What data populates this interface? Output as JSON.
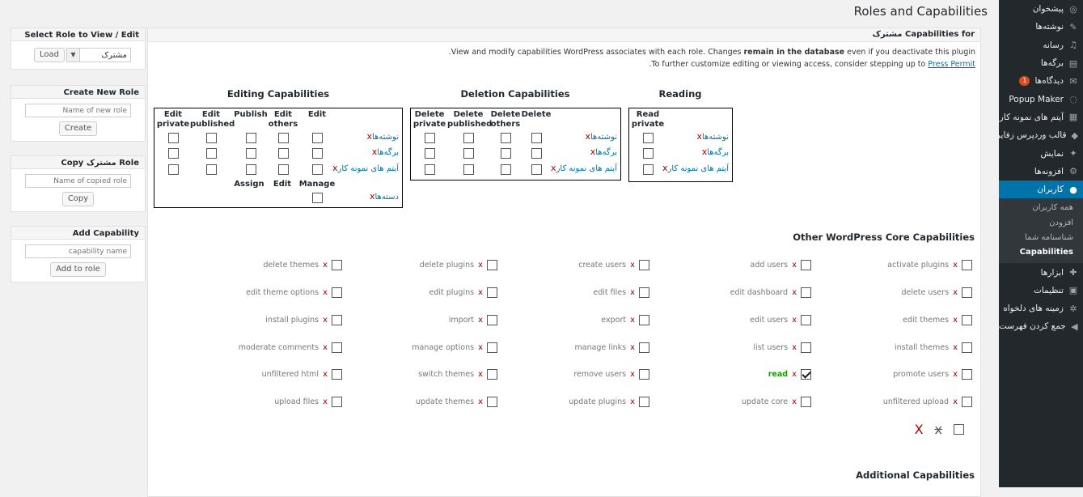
{
  "page": {
    "title": "Roles and Capabilities"
  },
  "admin_menu": {
    "items": [
      {
        "label": "پیشخوان",
        "icon": "dashboard-icon",
        "glyph": "◎"
      },
      {
        "label": "نوشته‌ها",
        "icon": "pin-icon",
        "glyph": "✎"
      },
      {
        "label": "رسانه",
        "icon": "media-icon",
        "glyph": "♫"
      },
      {
        "label": "برگه‌ها",
        "icon": "page-icon",
        "glyph": "▤"
      },
      {
        "label": "دیدگاه‌ها",
        "icon": "comment-icon",
        "glyph": "✉",
        "badge": "1"
      },
      {
        "label": "Popup Maker",
        "icon": "popup-icon",
        "glyph": "◌"
      },
      {
        "label": "آیتم های نمونه کار",
        "icon": "portfolio-icon",
        "glyph": "▦"
      },
      {
        "label": "قالب وردپرس زفایر",
        "icon": "diamond-icon",
        "glyph": "◆"
      },
      {
        "label": "نمایش",
        "icon": "appearance-icon",
        "glyph": "✦"
      },
      {
        "label": "افزونه‌ها",
        "icon": "plugin-icon",
        "glyph": "⚙"
      },
      {
        "label": "کاربران",
        "icon": "user-icon",
        "glyph": "●",
        "active": true
      }
    ],
    "submenu": [
      "همه کاربران",
      "افزودن",
      "شناسنامه شما",
      "Capabilities"
    ],
    "items_after": [
      {
        "label": "ابزارها",
        "icon": "tools-icon",
        "glyph": "✚"
      },
      {
        "label": "تنظیمات",
        "icon": "settings-icon",
        "glyph": "▣"
      },
      {
        "label": "زمینه های دلخواه",
        "icon": "gear-icon",
        "glyph": "✲"
      },
      {
        "label": "جمع کردن فهرست",
        "icon": "collapse-icon",
        "glyph": "◀"
      }
    ]
  },
  "sidebar": {
    "select_role": {
      "title": "Select Role to View / Edit",
      "selected": "مشترک",
      "button": "Load"
    },
    "create_role": {
      "title": "Create New Role",
      "placeholder": "Name of new role",
      "button": "Create"
    },
    "copy_role": {
      "title": "Copy مشترک Role",
      "placeholder": "Name of copied role",
      "button": "Copy"
    },
    "add_capability": {
      "title": "Add Capability",
      "placeholder": "capability name",
      "button": "Add to role"
    }
  },
  "main": {
    "header": "Capabilities for مشترک",
    "intro_line1_a": "View and modify capabilities WordPress associates with each role. Changes ",
    "intro_line1_b": "remain in the database",
    "intro_line1_c": " even if you deactivate this plugin.",
    "intro_line2_a": "To further customize editing or viewing access, consider stepping up to ",
    "intro_line2_link": "Press Permit",
    "intro_line2_b": ".",
    "editing": {
      "title": "Editing Capabilities",
      "columns": [
        "Edit private",
        "Edit published",
        "Publish",
        "Edit others",
        "Edit"
      ],
      "rows": [
        "نوشته‌ها",
        "برگه‌ها",
        "آیتم های نمونه کار"
      ],
      "tax_columns": [
        "Assign",
        "Edit",
        "Manage"
      ],
      "tax_row": "دسته‌ها"
    },
    "deletion": {
      "title": "Deletion Capabilities",
      "columns": [
        "Delete private",
        "Delete published",
        "Delete others",
        "Delete"
      ],
      "rows": [
        "نوشته‌ها",
        "برگه‌ها",
        "آیتم های نمونه کار"
      ]
    },
    "reading": {
      "title": "Reading",
      "columns": [
        "Read private"
      ],
      "rows": [
        "نوشته‌ها",
        "برگه‌ها",
        "آیتم های نمونه کار"
      ]
    },
    "row_x": "x",
    "core": {
      "title": "Other WordPress Core Capabilities",
      "columns": [
        [
          "activate plugins",
          "delete users",
          "edit themes",
          "install themes",
          "promote users",
          "unfiltered upload"
        ],
        [
          "add users",
          "edit dashboard",
          "edit users",
          "list users",
          "read",
          "update core"
        ],
        [
          "create users",
          "edit files",
          "export",
          "manage links",
          "remove users",
          "update plugins"
        ],
        [
          "delete plugins",
          "edit plugins",
          "import",
          "manage options",
          "switch themes",
          "update themes"
        ],
        [
          "delete themes",
          "edit theme options",
          "install plugins",
          "moderate comments",
          "unfiltered html",
          "upload files"
        ]
      ],
      "checked": [
        "read"
      ],
      "x": "x",
      "extra_big_x": "X",
      "extra_strike_x": "x"
    },
    "additional_title": "Additional Capabilities"
  }
}
